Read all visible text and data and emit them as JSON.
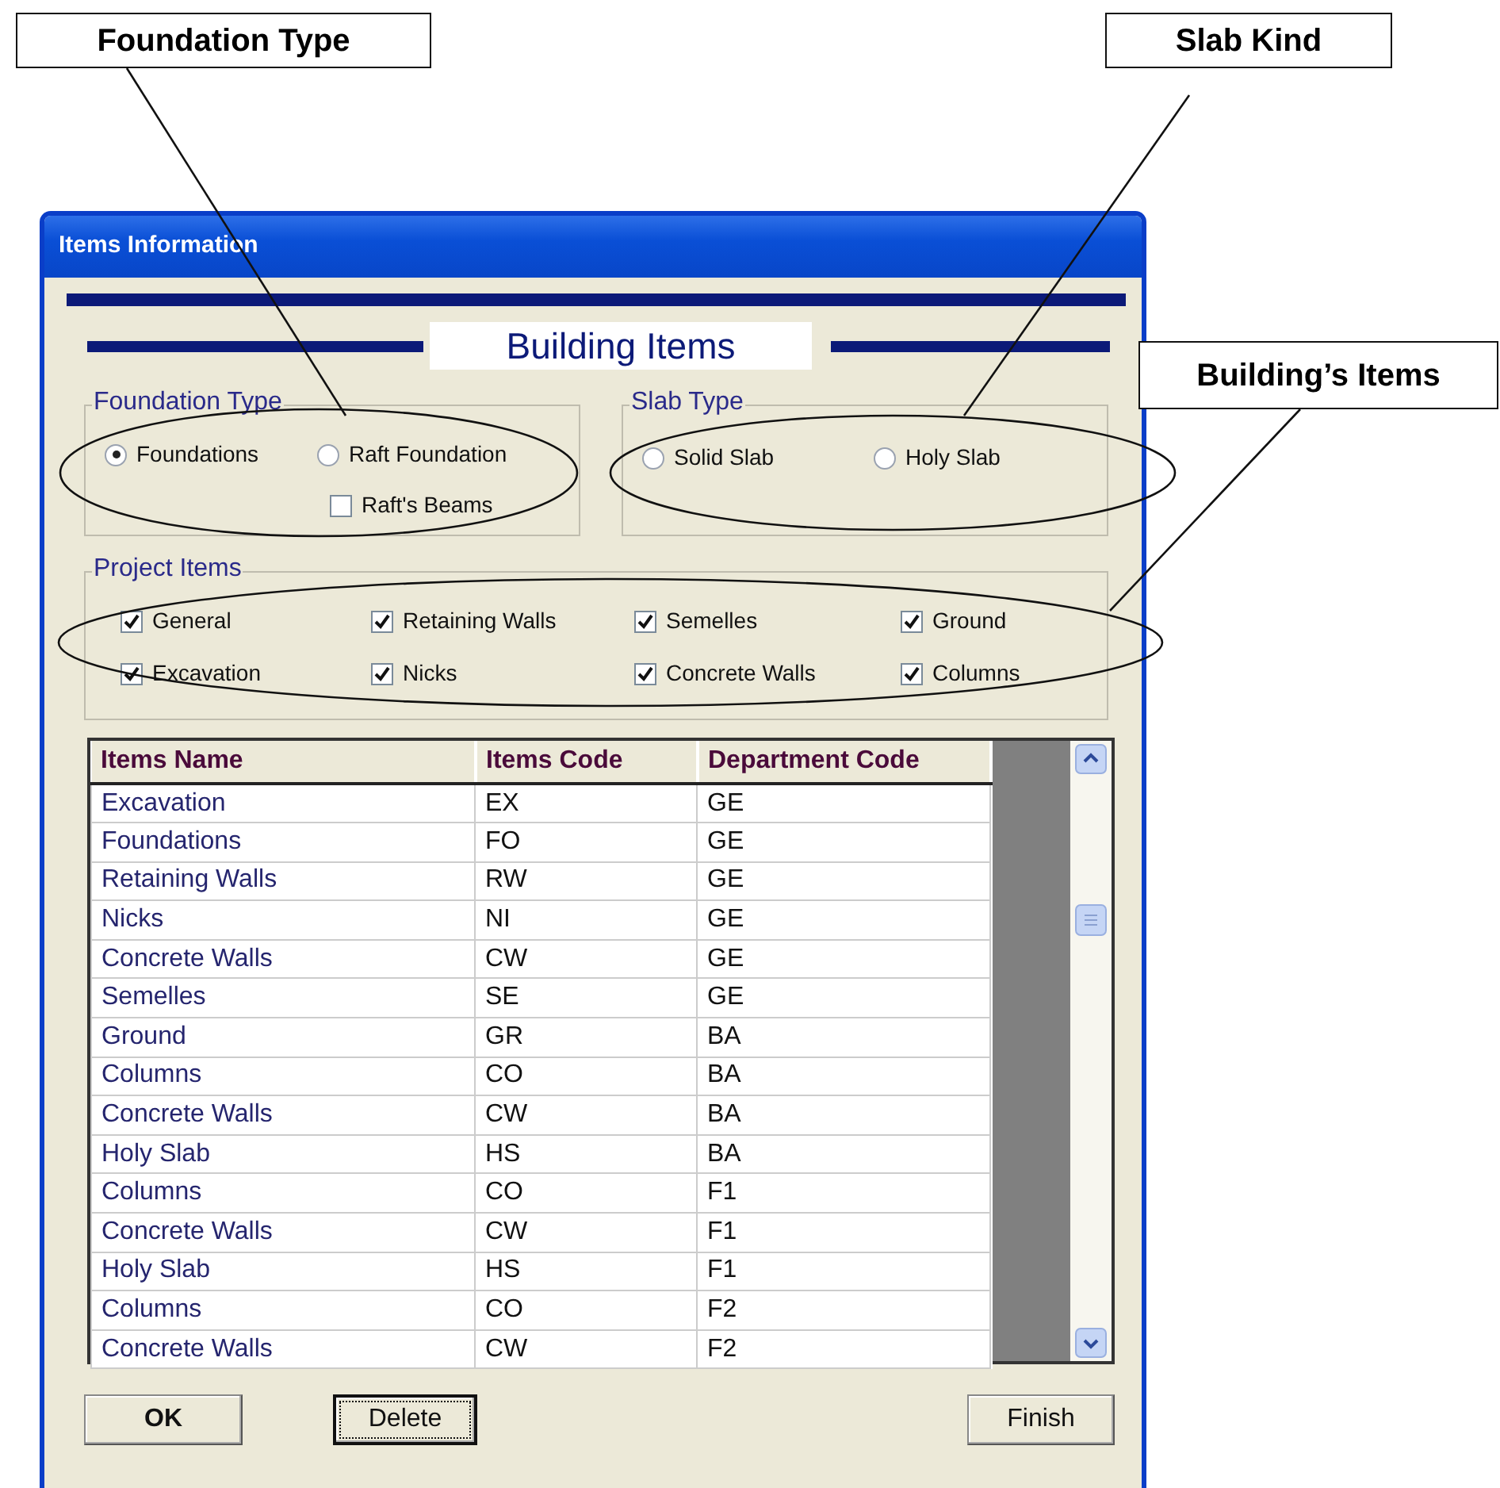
{
  "callouts": [
    {
      "text": "Foundation Type"
    },
    {
      "text": "Slab Kind"
    },
    {
      "text": "Building’s Items"
    }
  ],
  "window": {
    "title": "Items Information"
  },
  "header": "Building Items",
  "foundation_group": {
    "title": "Foundation Type",
    "options": [
      {
        "kind": "radio",
        "label": "Foundations",
        "selected": true
      },
      {
        "kind": "radio",
        "label": "Raft Foundation",
        "selected": false
      },
      {
        "kind": "checkbox",
        "label": "Raft's Beams",
        "checked": false
      }
    ]
  },
  "slab_group": {
    "title": "Slab Type",
    "options": [
      {
        "kind": "radio",
        "label": "Solid Slab",
        "selected": false
      },
      {
        "kind": "radio",
        "label": "Holy Slab",
        "selected": false
      }
    ]
  },
  "project_items": {
    "title": "Project Items",
    "items": [
      {
        "label": "General",
        "checked": true
      },
      {
        "label": "Retaining Walls",
        "checked": true
      },
      {
        "label": "Semelles",
        "checked": true
      },
      {
        "label": "Ground",
        "checked": true
      },
      {
        "label": "Excavation",
        "checked": true
      },
      {
        "label": "Nicks",
        "checked": true
      },
      {
        "label": "Concrete Walls",
        "checked": true
      },
      {
        "label": "Columns",
        "checked": true
      }
    ]
  },
  "table": {
    "columns": [
      "Items Name",
      "Items Code",
      "Department Code"
    ],
    "rows": [
      [
        "Excavation",
        "EX",
        "GE"
      ],
      [
        "Foundations",
        "FO",
        "GE"
      ],
      [
        "Retaining Walls",
        "RW",
        "GE"
      ],
      [
        "Nicks",
        "NI",
        "GE"
      ],
      [
        "Concrete Walls",
        "CW",
        "GE"
      ],
      [
        "Semelles",
        "SE",
        "GE"
      ],
      [
        "Ground",
        "GR",
        "BA"
      ],
      [
        "Columns",
        "CO",
        "BA"
      ],
      [
        "Concrete Walls",
        "CW",
        "BA"
      ],
      [
        "Holy Slab",
        "HS",
        "BA"
      ],
      [
        "Columns",
        "CO",
        "F1"
      ],
      [
        "Concrete Walls",
        "CW",
        "F1"
      ],
      [
        "Holy Slab",
        "HS",
        "F1"
      ],
      [
        "Columns",
        "CO",
        "F2"
      ],
      [
        "Concrete Walls",
        "CW",
        "F2"
      ]
    ]
  },
  "buttons": [
    {
      "label": "OK",
      "focused": false
    },
    {
      "label": "Delete",
      "focused": true
    },
    {
      "label": "Finish",
      "focused": false
    }
  ]
}
